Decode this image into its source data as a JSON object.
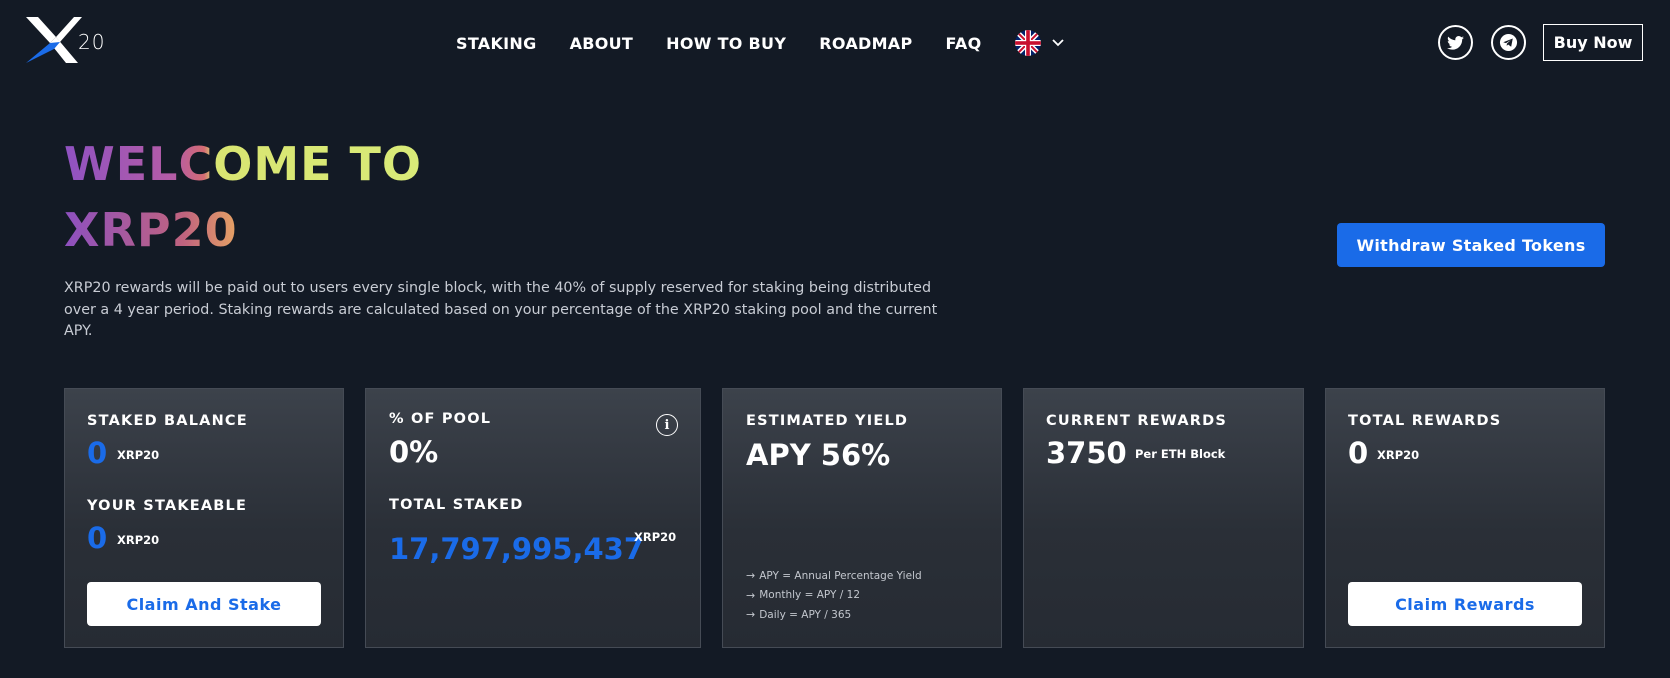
{
  "header": {
    "logo_text": "20",
    "nav": [
      "STAKING",
      "ABOUT",
      "HOW TO BUY",
      "ROADMAP",
      "FAQ"
    ],
    "language_icon": "uk-flag-icon",
    "buy_label": "Buy Now"
  },
  "hero": {
    "title_line1": "WELCOME TO",
    "title_line2": "XRP20",
    "description": "XRP20 rewards will be paid out to users every single block, with the 40% of supply reserved for staking being distributed over a 4 year period. Staking rewards are calculated based on your percentage of the XRP20 staking pool and the current APY.",
    "withdraw_label": "Withdraw Staked Tokens"
  },
  "cards": {
    "staked": {
      "label": "STAKED BALANCE",
      "value": "0",
      "unit": "XRP20",
      "stakeable_label": "YOUR STAKEABLE",
      "stakeable_value": "0",
      "stakeable_unit": "XRP20",
      "button": "Claim And Stake"
    },
    "pool": {
      "label": "% OF POOL",
      "value": "0%",
      "info_glyph": "i",
      "total_label": "TOTAL STAKED",
      "total_value": "17,797,995,437",
      "total_unit": "XRP20"
    },
    "yield": {
      "label": "ESTIMATED YIELD",
      "value": "APY 56%",
      "notes": [
        "APY = Annual Percentage Yield",
        "Monthly = APY / 12",
        "Daily = APY / 365"
      ]
    },
    "current": {
      "label": "CURRENT REWARDS",
      "value": "3750",
      "unit": "Per ETH Block"
    },
    "total": {
      "label": "TOTAL REWARDS",
      "value": "0",
      "unit": "XRP20",
      "button": "Claim Rewards"
    }
  },
  "colors": {
    "background": "#131a25",
    "accent_blue": "#1a6be8",
    "card_top": "#3c424b",
    "card_bottom": "#262b33"
  }
}
